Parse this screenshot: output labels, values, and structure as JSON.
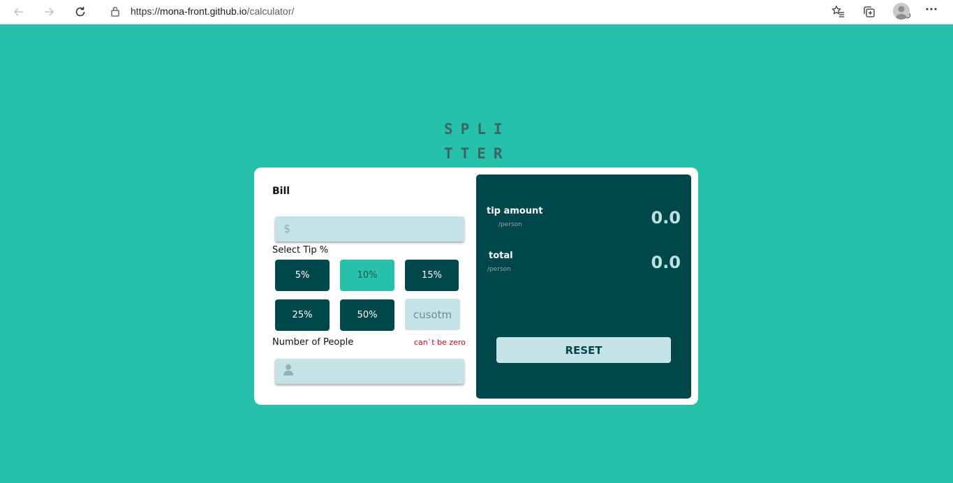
{
  "browser": {
    "url_scheme": "https://",
    "url_host": "mona-front.github.io",
    "url_path": "/calculator/"
  },
  "logo": {
    "line1": "SPLI",
    "line2": "TTER"
  },
  "bill": {
    "label": "Bill",
    "currency_symbol": "$",
    "value": ""
  },
  "tip": {
    "label": "Select Tip %",
    "options": [
      "5%",
      "10%",
      "15%",
      "25%",
      "50%"
    ],
    "selected": "10%",
    "custom_placeholder": "cusotm"
  },
  "people": {
    "label": "Number of People",
    "error": "can`t be zero",
    "value": ""
  },
  "results": {
    "tip_amount_label": "tip amount",
    "tip_amount_sub": "/person",
    "tip_amount_value": "0.0",
    "total_label": "total",
    "total_sub": "/person",
    "total_value": "0.0",
    "reset_label": "RESET"
  },
  "colors": {
    "background": "#26c0ab",
    "dark_cyan": "#00474b",
    "light_cyan": "#c5e3e6",
    "error": "#d0021b"
  }
}
